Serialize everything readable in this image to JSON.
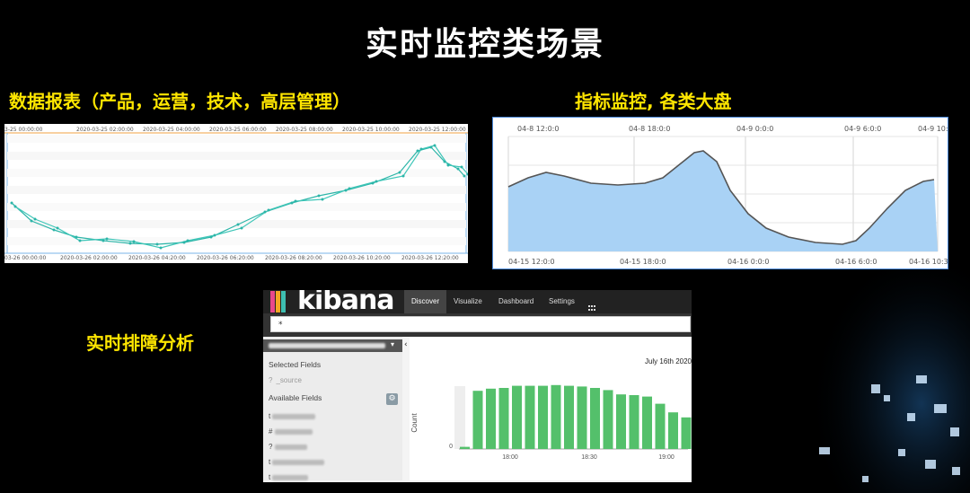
{
  "slide_title": "实时监控类场景",
  "labels": {
    "reports": "数据报表（产品，运营，技术，高层管理）",
    "metrics": "指标监控, 各类大盘",
    "troubleshoot": "实时排障分析"
  },
  "colors": {
    "accent_yellow": "#ffe600",
    "teal": "#2cb5a8",
    "kibana_green": "#54c06b",
    "area_fill": "#a9d2f5"
  },
  "chart_reports": {
    "top_ticks": [
      "3-25 00:00:00",
      "2020-03-25 02:00:00",
      "2020-03-25 04:00:00",
      "2020-03-25 06:00:00",
      "2020-03-25 08:00:00",
      "2020-03-25 10:00:00",
      "2020-03-25 12:00:00"
    ],
    "bottom_ticks": [
      "03-26 00:00:00",
      "2020-03-26 02:00:00",
      "2020-03-26 04:20:00",
      "2020-03-26 06:20:00",
      "2020-03-26 08:20:00",
      "2020-03-26 10:20:00",
      "2020-03-26 12:20:00"
    ]
  },
  "chart_metrics": {
    "top_ticks": [
      "04-8 12:0:0",
      "04-8 18:0:0",
      "04-9 0:0:0",
      "04-9 6:0:0",
      "04-9 10:35:4"
    ],
    "bottom_ticks": [
      "04-15 12:0:0",
      "04-15 18:0:0",
      "04-16 0:0:0",
      "04-16 6:0:0",
      "04-16 10:35:4"
    ]
  },
  "kibana": {
    "logo": "kibana",
    "nav": [
      "Discover",
      "Visualize",
      "Dashboard",
      "Settings"
    ],
    "query": "*",
    "selected_fields_title": "Selected Fields",
    "selected_field": "_source",
    "available_fields_title": "Available Fields",
    "field_types": [
      "t",
      "#",
      "?",
      "t",
      "t"
    ],
    "date_label": "July 16th 2020",
    "y_axis_label": "Count",
    "y_ticks": [
      "0"
    ],
    "x_ticks": [
      "18:00",
      "18:30",
      "19:00"
    ],
    "bars": [
      0.03,
      0.81,
      0.84,
      0.85,
      0.88,
      0.88,
      0.88,
      0.89,
      0.88,
      0.87,
      0.85,
      0.82,
      0.76,
      0.75,
      0.73,
      0.63,
      0.51,
      0.44
    ]
  }
}
